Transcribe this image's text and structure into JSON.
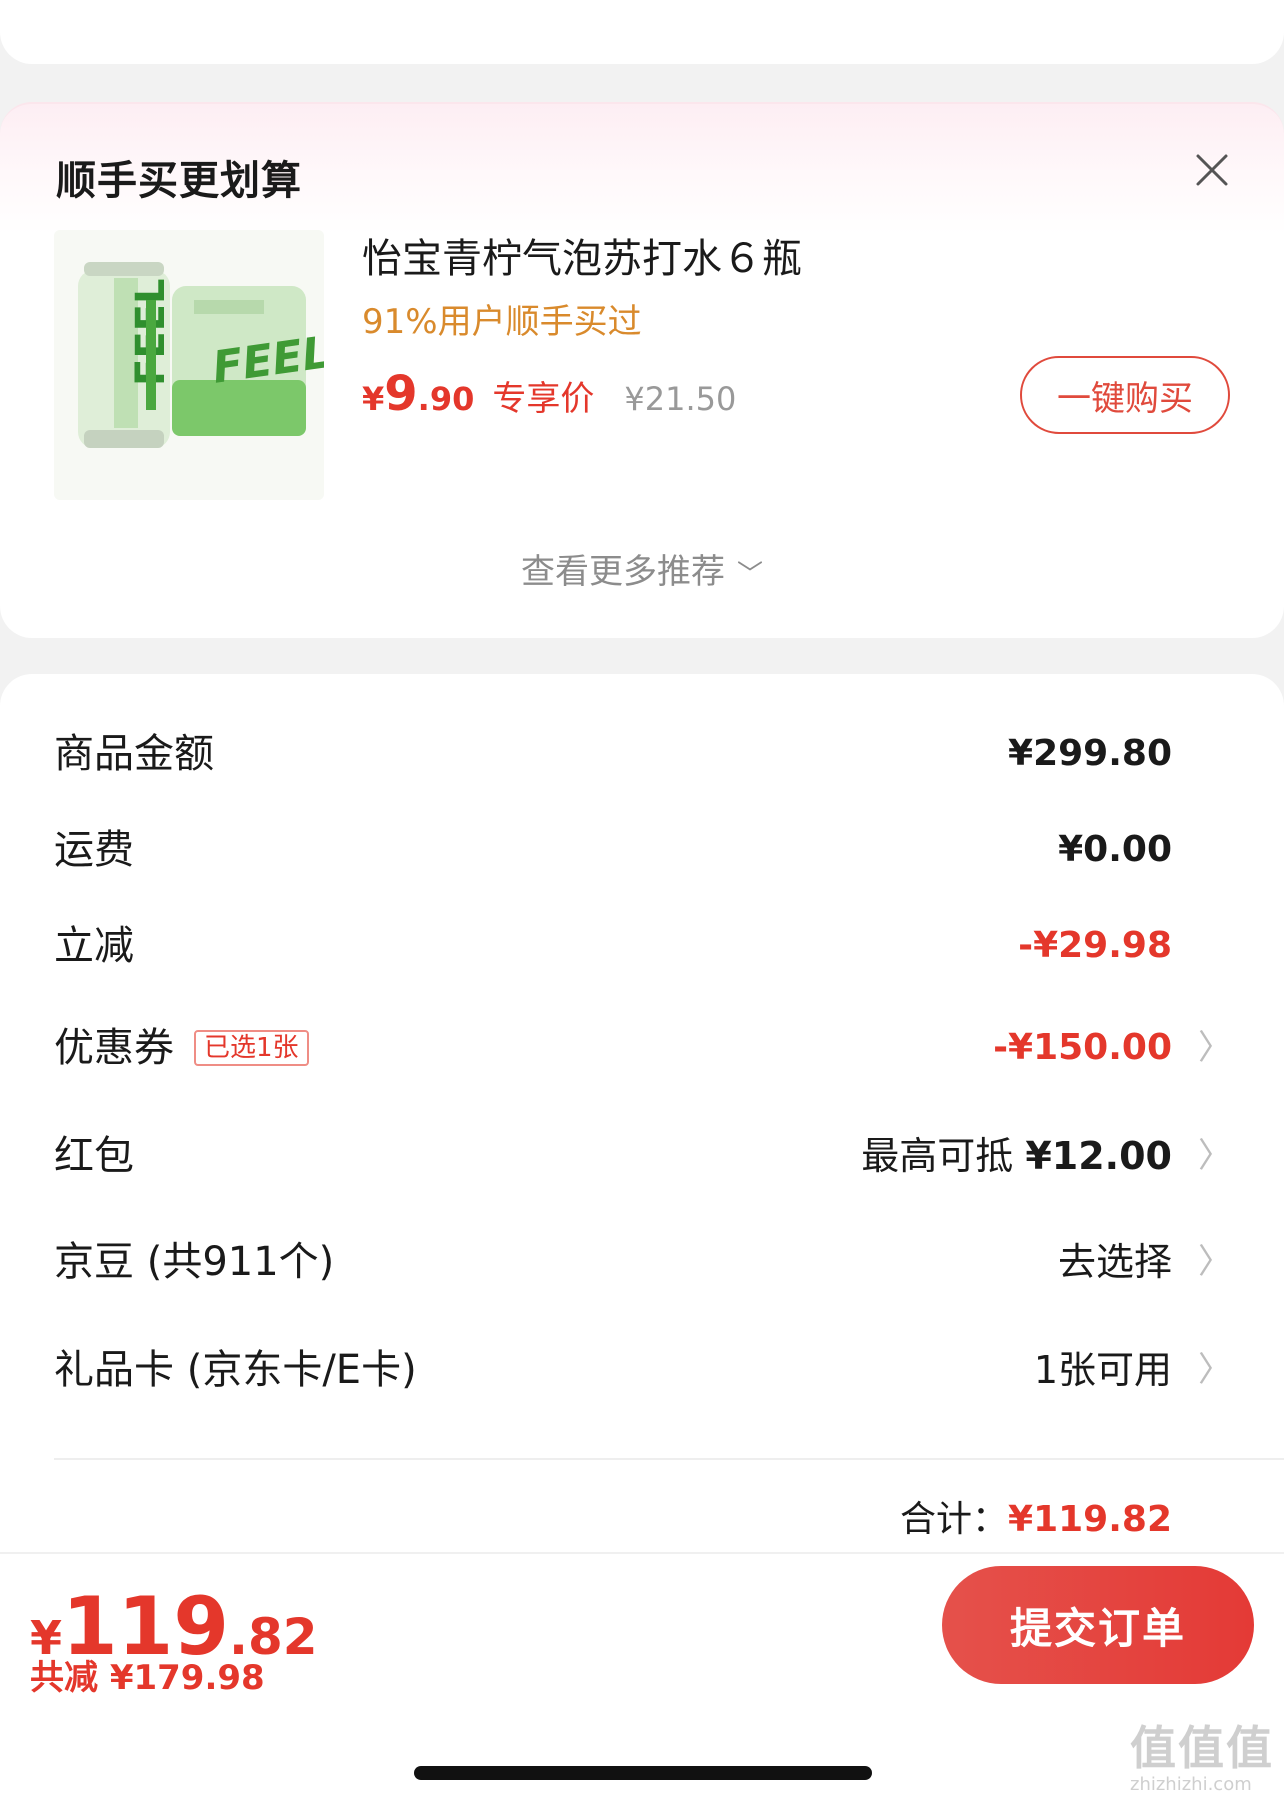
{
  "recommend": {
    "title": "顺手买更划算",
    "close_icon": "close-icon",
    "product": {
      "name": "怡宝青柠气泡苏打水６瓶",
      "subtitle": "91%用户顺手买过",
      "price_symbol": "¥",
      "price_int": "9",
      "price_dec": ".90",
      "price_tag": "专享价",
      "original_price": "¥21.50",
      "image_brand_text": "FEEL"
    },
    "buy_button": "一键购买",
    "more_label": "查看更多推荐",
    "more_icon": "chevron-down-icon"
  },
  "summary": {
    "rows": [
      {
        "label": "商品金额",
        "value": "¥299.80"
      },
      {
        "label": "运费",
        "value": "¥0.00"
      },
      {
        "label": "立减",
        "value": "-¥29.98"
      },
      {
        "label": "优惠券",
        "badge": "已选1张",
        "value": "-¥150.00"
      },
      {
        "label": "红包",
        "value_prefix": "最高可抵",
        "value": "¥12.00"
      },
      {
        "label": "京豆 (共911个)",
        "value": "去选择"
      },
      {
        "label": "礼品卡 (京东卡/E卡)",
        "value": "1张可用"
      }
    ],
    "arrow_glyph": "〉",
    "total_label": "合计：",
    "total_value": "¥119.82"
  },
  "bottom_bar": {
    "price_symbol": "¥",
    "price_int": "119",
    "price_dec": ".82",
    "saved": "共减 ¥179.98",
    "submit": "提交订单"
  },
  "watermark": {
    "main": "值值值",
    "sub": "zhizhizhi.com"
  },
  "colors": {
    "accent_red": "#e4372b",
    "orange": "#d98a2c",
    "muted": "#999999"
  }
}
